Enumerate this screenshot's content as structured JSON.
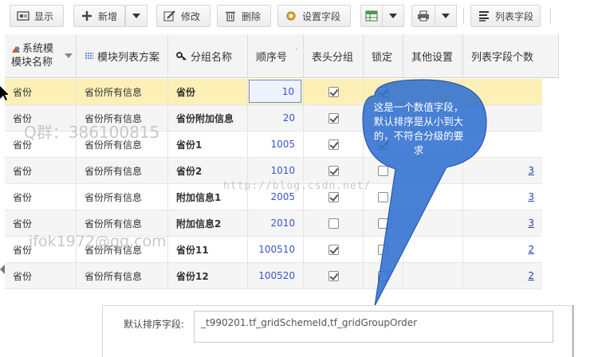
{
  "toolbar": {
    "show": "显示",
    "add": "新增",
    "edit": "修改",
    "delete": "删除",
    "set_fields": "设置字段",
    "list_fields": "列表字段"
  },
  "columns": {
    "system_module": "系统模",
    "module_name": "模块名称",
    "scheme": "模块列表方案",
    "group_name": "分组名称",
    "order": "顺序号",
    "header_group": "表头分组",
    "lock": "锁定",
    "other": "其他设置",
    "field_count": "列表字段个数"
  },
  "rows": [
    {
      "module": "省份",
      "scheme": "省份所有信息",
      "group": "省份",
      "order": "10",
      "header": true,
      "lock": true,
      "count": ""
    },
    {
      "module": "省份",
      "scheme": "省份所有信息",
      "group": "省份附加信息",
      "order": "20",
      "header": true,
      "lock": true,
      "count": ""
    },
    {
      "module": "省份",
      "scheme": "省份所有信息",
      "group": "省份1",
      "order": "1005",
      "header": true,
      "lock": true,
      "count": ""
    },
    {
      "module": "省份",
      "scheme": "省份所有信息",
      "group": "省份2",
      "order": "1010",
      "header": true,
      "lock": false,
      "count": "3"
    },
    {
      "module": "省份",
      "scheme": "省份所有信息",
      "group": "附加信息1",
      "order": "2005",
      "header": true,
      "lock": false,
      "count": "3"
    },
    {
      "module": "省份",
      "scheme": "省份所有信息",
      "group": "附加信息2",
      "order": "2010",
      "header": false,
      "lock": false,
      "count": "3"
    },
    {
      "module": "省份",
      "scheme": "省份所有信息",
      "group": "省份11",
      "order": "100510",
      "header": true,
      "lock": false,
      "count": "2"
    },
    {
      "module": "省份",
      "scheme": "省份所有信息",
      "group": "省份12",
      "order": "100520",
      "header": true,
      "lock": false,
      "count": "2"
    }
  ],
  "callout": "这是一个数值字段，默认排序是从小到大的，不符合分级的要求",
  "watermarks": {
    "qq": "Q群：386100815",
    "blog": "http://blog.csdn.net/",
    "email": "jfok1972@qq.com"
  },
  "panel": {
    "label": "默认排序字段:",
    "value": "_t990201.tf_gridSchemeId,tf_gridGroupOrder"
  },
  "colors": {
    "callout_fill": "#2f6fcf",
    "selected_row": "#fdf0b6",
    "number_text": "#3a55c8"
  }
}
